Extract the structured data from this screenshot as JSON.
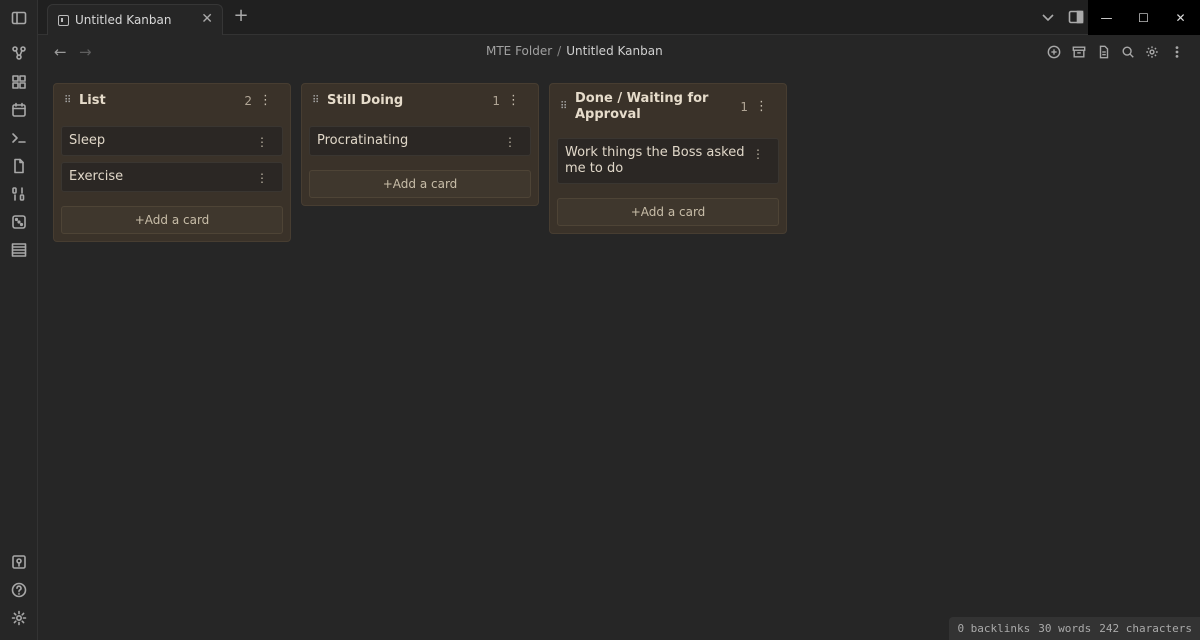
{
  "tab": {
    "title": "Untitled Kanban"
  },
  "breadcrumb": {
    "folder": "MTE Folder",
    "separator": "/",
    "file": "Untitled Kanban"
  },
  "board": {
    "lanes": [
      {
        "title": "List",
        "count": "2",
        "cards": [
          "Sleep",
          "Exercise"
        ],
        "add_label": "+Add a card"
      },
      {
        "title": "Still Doing",
        "count": "1",
        "cards": [
          "Procratinating"
        ],
        "add_label": "+Add a card"
      },
      {
        "title": "Done / Waiting for Approval",
        "count": "1",
        "cards": [
          "Work things the Boss asked me to do"
        ],
        "add_label": "+Add a card"
      }
    ]
  },
  "status": {
    "backlinks": "0 backlinks",
    "words": "30 words",
    "characters": "242 characters"
  },
  "colors": {
    "lane_bg": "#3a3229",
    "card_bg": "#2b2724",
    "app_bg": "#262626"
  }
}
